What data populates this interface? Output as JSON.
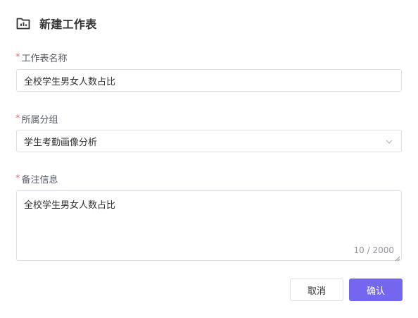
{
  "dialog": {
    "title": "新建工作表",
    "title_icon": "folder-chart-icon"
  },
  "form": {
    "name_field": {
      "required_mark": "*",
      "label": "工作表名称",
      "value": "全校学生男女人数占比"
    },
    "group_field": {
      "required_mark": "*",
      "label": "所属分组",
      "selected": "学生考勤画像分析",
      "icon": "chevron-down-icon"
    },
    "notes_field": {
      "required_mark": "*",
      "label": "备注信息",
      "value": "全校学生男女人数占比",
      "counter": "10 / 2000"
    }
  },
  "footer": {
    "cancel_label": "取消",
    "confirm_label": "确认"
  },
  "colors": {
    "accent": "#7367f0",
    "required": "#f56c6c",
    "border": "#dcdfe6"
  }
}
